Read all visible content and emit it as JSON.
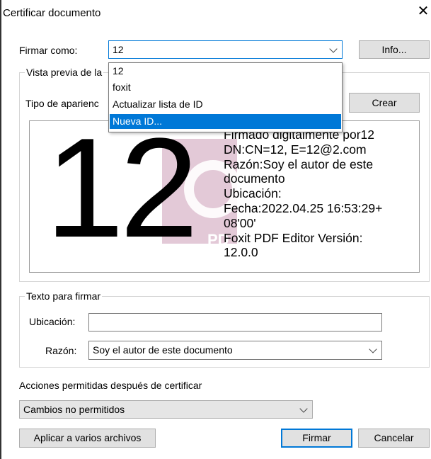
{
  "dialog": {
    "title": "Certificar documento",
    "close_glyph": "✕"
  },
  "sign_as": {
    "label": "Firmar como:",
    "value": "12",
    "info_button": "Info...",
    "dropdown_options": [
      "12",
      "foxit",
      "Actualizar lista de ID",
      "Nueva ID..."
    ],
    "selected_option": "Nueva ID..."
  },
  "preview": {
    "group_label": "Vista previa de la",
    "type_label": "Tipo de aparienc",
    "create_button": "Crear",
    "big_name": "12",
    "watermark_text": "PD",
    "sig_lines": [
      "Firmado digitalmente por12",
      "DN:CN=12, E=12@2.com",
      "Razón:Soy el autor de este",
      "documento",
      "Ubicación:",
      "Fecha:2022.04.25 16:53:29+",
      "08'00'",
      "Foxit PDF Editor Versión:",
      "12.0.0"
    ]
  },
  "text_to_sign": {
    "group_label": "Texto para firmar",
    "location_label": "Ubicación:",
    "location_value": "",
    "reason_label": "Razón:",
    "reason_value": "Soy el autor de este documento"
  },
  "permissions": {
    "label": "Acciones permitidas después de certificar",
    "value": "Cambios no permitidos"
  },
  "buttons": {
    "apply_multiple": "Aplicar a varios archivos",
    "sign": "Firmar",
    "cancel": "Cancelar"
  },
  "colors": {
    "accent": "#0078d7",
    "button_face": "#e1e1e1"
  },
  "icons": [
    "close-icon",
    "chevron-down-icon"
  ]
}
